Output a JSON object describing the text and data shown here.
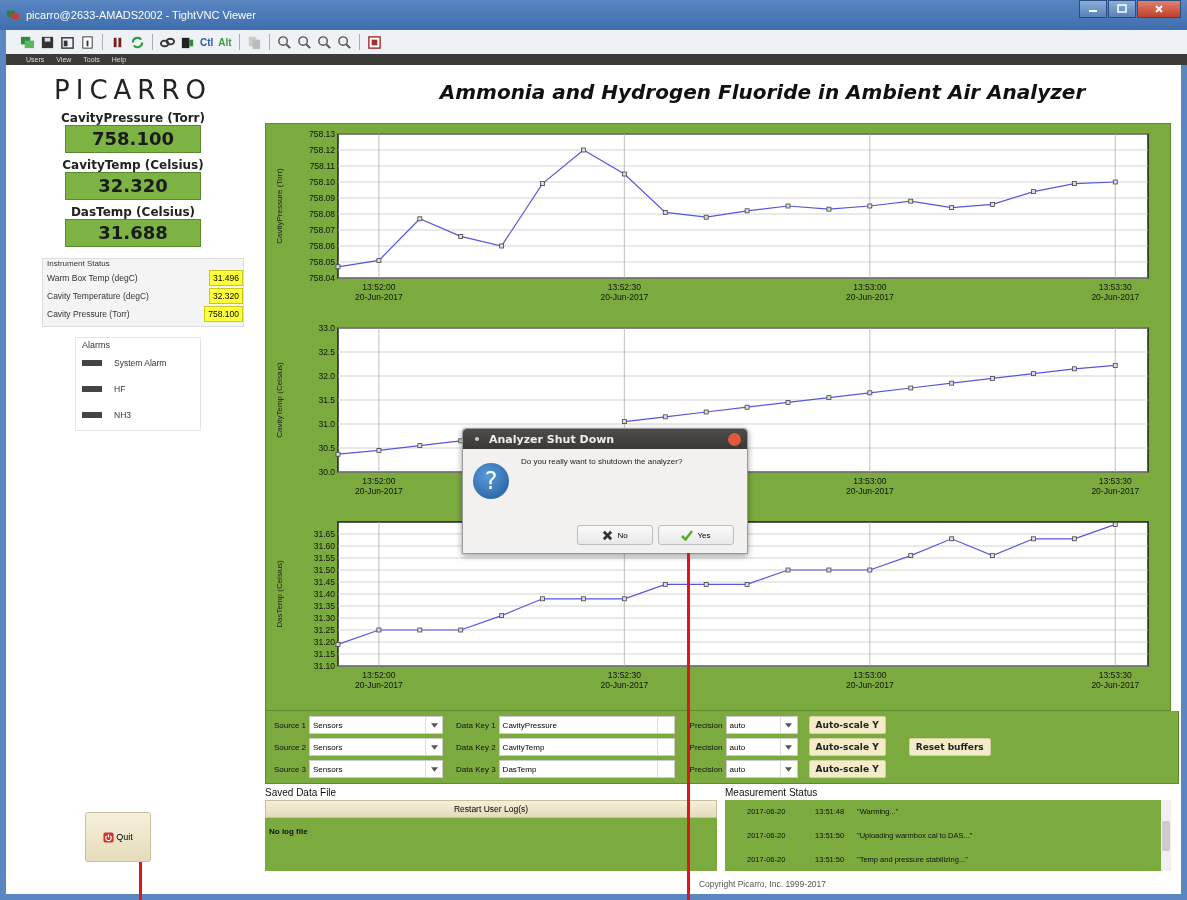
{
  "window": {
    "title": "picarro@2633-AMADS2002 - TightVNC Viewer"
  },
  "toolbar": {
    "key_labels": [
      "Ctl",
      "Alt"
    ]
  },
  "menu": [
    "Users",
    "View",
    "Tools",
    "Help"
  ],
  "logo": "PICARRO",
  "app_title": "Ammonia and Hydrogen Fluoride in Ambient Air Analyzer",
  "readouts": [
    {
      "label": "CavityPressure (Torr)",
      "value": "758.100"
    },
    {
      "label": "CavityTemp (Celsius)",
      "value": "32.320"
    },
    {
      "label": "DasTemp (Celsius)",
      "value": "31.688"
    }
  ],
  "instrument_status": {
    "title": "Instrument Status",
    "rows": [
      {
        "label": "Warm Box Temp (degC)",
        "value": "31.496"
      },
      {
        "label": "Cavity Temperature (degC)",
        "value": "32.320"
      },
      {
        "label": "Cavity Pressure (Torr)",
        "value": "758.100"
      }
    ]
  },
  "alarms": {
    "title": "Alarms",
    "items": [
      {
        "label": "System Alarm",
        "on": false
      },
      {
        "label": "HF",
        "on": false
      },
      {
        "label": "NH3",
        "on": false
      }
    ]
  },
  "charts": [
    {
      "chart_data": {
        "type": "line",
        "grid": true,
        "marker": true,
        "ylabel": "CavityPressure (Torr)",
        "ylim": [
          758.04,
          758.13
        ],
        "categories": [
          null,
          "13:52:00\n20-Jun-2017",
          null,
          null,
          null,
          null,
          null,
          "13:52:30\n20-Jun-2017",
          null,
          null,
          null,
          null,
          null,
          "13:53:00\n20-Jun-2017",
          null,
          null,
          null,
          null,
          null,
          "13:53:30\n20-Jun-2017"
        ],
        "values": [
          758.047,
          758.051,
          758.077,
          758.066,
          758.06,
          758.099,
          758.12,
          758.105,
          758.081,
          758.078,
          758.082,
          758.085,
          758.083,
          758.085,
          758.088,
          758.084,
          758.086,
          758.094,
          758.099,
          758.1
        ],
        "yticks": [
          {
            "value": 758.04,
            "label": "758.04"
          },
          {
            "value": 758.05,
            "label": "758.05"
          },
          {
            "value": 758.06,
            "label": "758.06"
          },
          {
            "value": 758.07,
            "label": "758.07"
          },
          {
            "value": 758.08,
            "label": "758.08"
          },
          {
            "value": 758.09,
            "label": "758.09"
          },
          {
            "value": 758.1,
            "label": "758.10"
          },
          {
            "value": 758.11,
            "label": "758.11"
          },
          {
            "value": 758.12,
            "label": "758.12"
          },
          {
            "value": 758.13,
            "label": "758.13"
          }
        ]
      }
    },
    {
      "chart_data": {
        "type": "line",
        "grid": true,
        "marker": true,
        "ylabel": "CavityTemp (Celsius)",
        "ylim": [
          30.0,
          33.0
        ],
        "categories": [
          null,
          "13:52:00\n20-Jun-2017",
          null,
          null,
          null,
          null,
          null,
          null,
          null,
          null,
          null,
          null,
          null,
          "13:53:00\n20-Jun-2017",
          null,
          null,
          null,
          null,
          null,
          "13:53:30\n20-Jun-2017"
        ],
        "values": [
          30.37,
          30.45,
          30.55,
          30.65,
          null,
          null,
          null,
          31.05,
          31.15,
          31.25,
          31.35,
          31.45,
          31.55,
          31.65,
          31.75,
          31.85,
          31.95,
          32.05,
          32.15,
          32.22
        ],
        "yticks": [
          {
            "value": 30.0,
            "label": "30.0"
          },
          {
            "value": 30.5,
            "label": "30.5"
          },
          {
            "value": 31.0,
            "label": "31.0"
          },
          {
            "value": 31.5,
            "label": "31.5"
          },
          {
            "value": 32.0,
            "label": "32.0"
          },
          {
            "value": 32.5,
            "label": "32.5"
          },
          {
            "value": 33.0,
            "label": "33.0"
          }
        ]
      }
    },
    {
      "chart_data": {
        "type": "line",
        "grid": true,
        "marker": true,
        "ylabel": "DasTemp (Celsius)",
        "ylim": [
          31.1,
          31.7
        ],
        "categories": [
          null,
          "13:52:00\n20-Jun-2017",
          null,
          null,
          null,
          null,
          null,
          "13:52:30\n20-Jun-2017",
          null,
          null,
          null,
          null,
          null,
          "13:53:00\n20-Jun-2017",
          null,
          null,
          null,
          null,
          null,
          "13:53:30\n20-Jun-2017"
        ],
        "values": [
          31.19,
          31.25,
          31.25,
          31.25,
          31.31,
          31.38,
          31.38,
          31.38,
          31.44,
          31.44,
          31.44,
          31.5,
          31.5,
          31.5,
          31.56,
          31.63,
          31.56,
          31.63,
          31.63,
          31.69
        ],
        "yticks": [
          {
            "value": 31.1,
            "label": "31.10"
          },
          {
            "value": 31.15,
            "label": "31.15"
          },
          {
            "value": 31.2,
            "label": "31.20"
          },
          {
            "value": 31.25,
            "label": "31.25"
          },
          {
            "value": 31.3,
            "label": "31.30"
          },
          {
            "value": 31.35,
            "label": "31.35"
          },
          {
            "value": 31.4,
            "label": "31.40"
          },
          {
            "value": 31.45,
            "label": "31.45"
          },
          {
            "value": 31.5,
            "label": "31.50"
          },
          {
            "value": 31.55,
            "label": "31.55"
          },
          {
            "value": 31.6,
            "label": "31.60"
          },
          {
            "value": 31.65,
            "label": "31.65"
          }
        ]
      }
    }
  ],
  "controls": [
    {
      "source_label": "Source 1",
      "source": "Sensors",
      "key_label": "Data Key 1",
      "key": "CavityPressure",
      "precision_label": "Precision",
      "precision": "auto",
      "autoscale": "Auto-scale Y"
    },
    {
      "source_label": "Source 2",
      "source": "Sensors",
      "key_label": "Data Key 2",
      "key": "CavityTemp",
      "precision_label": "Precision",
      "precision": "auto",
      "autoscale": "Auto-scale Y"
    },
    {
      "source_label": "Source 3",
      "source": "Sensors",
      "key_label": "Data Key 3",
      "key": "DasTemp",
      "precision_label": "Precision",
      "precision": "auto",
      "autoscale": "Auto-scale Y"
    }
  ],
  "reset_button": "Reset buffers",
  "saved_data": {
    "title": "Saved Data File",
    "button": "Restart User Log(s)",
    "text": "No log file"
  },
  "measurement_status": {
    "title": "Measurement Status",
    "rows": [
      {
        "date": "2017-06-20",
        "time": "13:51:48",
        "message": "\"Warming...\""
      },
      {
        "date": "2017-06-20",
        "time": "13:51:50",
        "message": "\"Uploading warmbox cal to DAS...\""
      },
      {
        "date": "2017-06-20",
        "time": "13:51:50",
        "message": "\"Temp and pressure stabilizing...\""
      }
    ]
  },
  "quit_button": "Quit",
  "copyright": "Copyright Picarro, Inc. 1999-2017",
  "dialog": {
    "title": "Analyzer Shut Down",
    "icon": "?",
    "message": "Do you really want to shutdown the analyzer?",
    "buttons": [
      {
        "label": "No",
        "kind": "no"
      },
      {
        "label": "Yes",
        "kind": "yes"
      }
    ]
  }
}
